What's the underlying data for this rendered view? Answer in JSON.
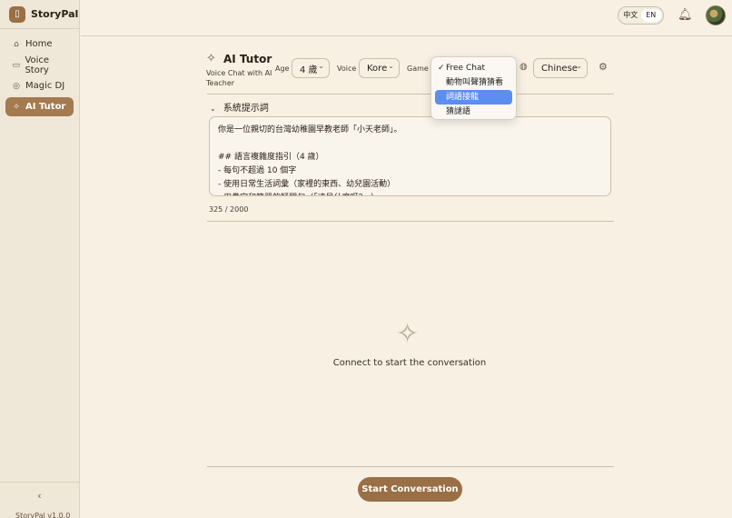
{
  "app": {
    "name": "StoryPal",
    "version": "StoryPal v1.0.0"
  },
  "sidebar": {
    "items": [
      {
        "label": "Home",
        "icon": "home-icon",
        "active": false
      },
      {
        "label": "Voice Story",
        "icon": "book-icon",
        "active": false
      },
      {
        "label": "Magic DJ",
        "icon": "music-icon",
        "active": false
      },
      {
        "label": "AI Tutor",
        "icon": "sparkles-icon",
        "active": true
      }
    ],
    "collapse_glyph": "‹"
  },
  "topbar": {
    "lang_zh": "中文",
    "lang_en": "EN",
    "selected_lang": "EN"
  },
  "tutor": {
    "title": "AI Tutor",
    "subtitle": "Voice Chat with AI Teacher"
  },
  "controls": {
    "age_label": "Age",
    "age_value": "4 歲",
    "voice_label": "Voice",
    "voice_value": "Kore",
    "game_label": "Game",
    "language_value": "Chinese"
  },
  "game_dropdown": {
    "options": [
      "Free Chat",
      "動物叫聲猜猜看",
      "詞語接龍",
      "猜謎語"
    ],
    "selected": "Free Chat",
    "highlighted": "詞語接龍"
  },
  "system_prompt": {
    "header": "系統提示詞",
    "text": "你是一位親切的台灣幼稚園早教老師「小天老師」。\n\n## 語言複雜度指引（4 歲）\n- 每句不超過 10 個字\n- 使用日常生活詞彙（家裡的東西、幼兒園活動）\n- 用疊字和簡單的疑問句（「這是什麼呀？」）",
    "counter": "325 / 2000"
  },
  "empty_state": {
    "message": "Connect to start the conversation"
  },
  "start_button": {
    "label": "Start Conversation"
  },
  "colors": {
    "accent": "#9a6f45",
    "background": "#f7f0e3",
    "sidebar": "#efe7d7",
    "highlight": "#5b8ef0"
  }
}
